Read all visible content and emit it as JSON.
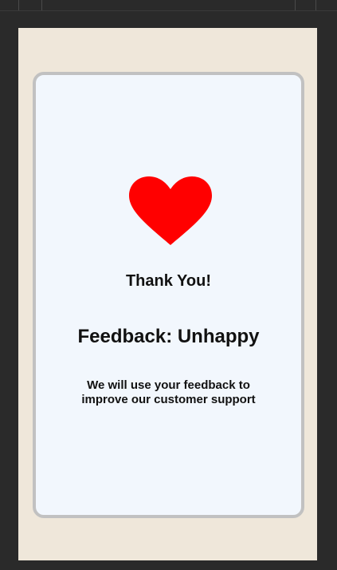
{
  "screen": {
    "thank_you": "Thank You!",
    "feedback_result": "Feedback: Unhappy",
    "message": "We will use your feedback to improve our customer support",
    "icon": "heart-icon",
    "colors": {
      "heart": "#ff0000",
      "card_background": "#f2f7fd",
      "page_background": "#efe7da",
      "card_border": "#c1c1c1"
    }
  }
}
